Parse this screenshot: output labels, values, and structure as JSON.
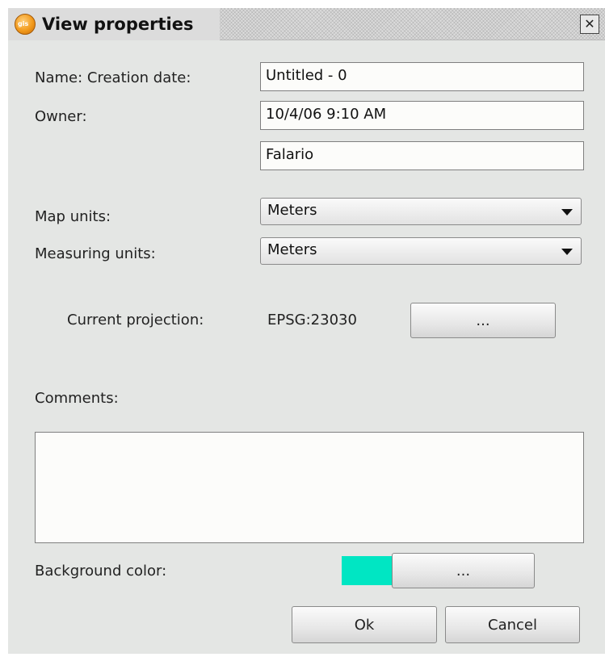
{
  "window": {
    "title": "View properties",
    "app_icon": "gis-globe-icon",
    "close_glyph": "✕"
  },
  "form": {
    "name_creation_label": "Name:  Creation date:",
    "owner_label": "Owner:",
    "name_value": "Untitled - 0",
    "creation_date_value": "10/4/06 9:10 AM",
    "owner_value": "Falario",
    "map_units_label": "Map units:",
    "map_units_value": "Meters",
    "measuring_units_label": "Measuring units:",
    "measuring_units_value": "Meters",
    "projection_label": "Current projection:",
    "projection_value": "EPSG:23030",
    "projection_button": "...",
    "comments_label": "Comments:",
    "comments_value": "",
    "background_color_label": "Background color:",
    "background_color_value": "#00e6c3",
    "background_color_button": "..."
  },
  "buttons": {
    "ok": "Ok",
    "cancel": "Cancel"
  }
}
